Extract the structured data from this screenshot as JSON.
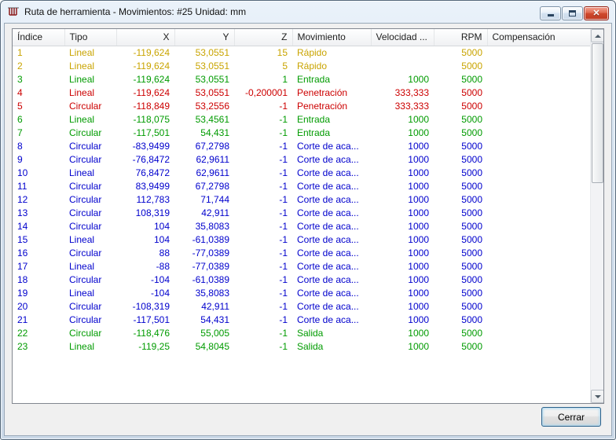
{
  "window": {
    "title": "Ruta de herramienta - Movimientos: #25 Unidad: mm"
  },
  "table": {
    "columns": [
      "Índice",
      "Tipo",
      "X",
      "Y",
      "Z",
      "Movimiento",
      "Velocidad ...",
      "RPM",
      "Compensación"
    ],
    "keys": [
      "indice",
      "tipo",
      "x",
      "y",
      "z",
      "movimiento",
      "velocidad",
      "rpm",
      "compensacion"
    ],
    "rows": [
      {
        "color": "rapido",
        "cells": [
          "1",
          "Lineal",
          "-119,624",
          "53,0551",
          "15",
          "Rápido",
          "",
          "5000",
          ""
        ]
      },
      {
        "color": "rapido",
        "cells": [
          "2",
          "Lineal",
          "-119,624",
          "53,0551",
          "5",
          "Rápido",
          "",
          "5000",
          ""
        ]
      },
      {
        "color": "entrada",
        "cells": [
          "3",
          "Lineal",
          "-119,624",
          "53,0551",
          "1",
          "Entrada",
          "1000",
          "5000",
          ""
        ]
      },
      {
        "color": "penetracion",
        "cells": [
          "4",
          "Lineal",
          "-119,624",
          "53,0551",
          "-0,200001",
          "Penetración",
          "333,333",
          "5000",
          ""
        ]
      },
      {
        "color": "penetracion",
        "cells": [
          "5",
          "Circular",
          "-118,849",
          "53,2556",
          "-1",
          "Penetración",
          "333,333",
          "5000",
          ""
        ]
      },
      {
        "color": "entrada",
        "cells": [
          "6",
          "Lineal",
          "-118,075",
          "53,4561",
          "-1",
          "Entrada",
          "1000",
          "5000",
          ""
        ]
      },
      {
        "color": "entrada",
        "cells": [
          "7",
          "Circular",
          "-117,501",
          "54,431",
          "-1",
          "Entrada",
          "1000",
          "5000",
          ""
        ]
      },
      {
        "color": "corte",
        "cells": [
          "8",
          "Circular",
          "-83,9499",
          "67,2798",
          "-1",
          "Corte de aca...",
          "1000",
          "5000",
          ""
        ]
      },
      {
        "color": "corte",
        "cells": [
          "9",
          "Circular",
          "-76,8472",
          "62,9611",
          "-1",
          "Corte de aca...",
          "1000",
          "5000",
          ""
        ]
      },
      {
        "color": "corte",
        "cells": [
          "10",
          "Lineal",
          "76,8472",
          "62,9611",
          "-1",
          "Corte de aca...",
          "1000",
          "5000",
          ""
        ]
      },
      {
        "color": "corte",
        "cells": [
          "11",
          "Circular",
          "83,9499",
          "67,2798",
          "-1",
          "Corte de aca...",
          "1000",
          "5000",
          ""
        ]
      },
      {
        "color": "corte",
        "cells": [
          "12",
          "Circular",
          "112,783",
          "71,744",
          "-1",
          "Corte de aca...",
          "1000",
          "5000",
          ""
        ]
      },
      {
        "color": "corte",
        "cells": [
          "13",
          "Circular",
          "108,319",
          "42,911",
          "-1",
          "Corte de aca...",
          "1000",
          "5000",
          ""
        ]
      },
      {
        "color": "corte",
        "cells": [
          "14",
          "Circular",
          "104",
          "35,8083",
          "-1",
          "Corte de aca...",
          "1000",
          "5000",
          ""
        ]
      },
      {
        "color": "corte",
        "cells": [
          "15",
          "Lineal",
          "104",
          "-61,0389",
          "-1",
          "Corte de aca...",
          "1000",
          "5000",
          ""
        ]
      },
      {
        "color": "corte",
        "cells": [
          "16",
          "Circular",
          "88",
          "-77,0389",
          "-1",
          "Corte de aca...",
          "1000",
          "5000",
          ""
        ]
      },
      {
        "color": "corte",
        "cells": [
          "17",
          "Lineal",
          "-88",
          "-77,0389",
          "-1",
          "Corte de aca...",
          "1000",
          "5000",
          ""
        ]
      },
      {
        "color": "corte",
        "cells": [
          "18",
          "Circular",
          "-104",
          "-61,0389",
          "-1",
          "Corte de aca...",
          "1000",
          "5000",
          ""
        ]
      },
      {
        "color": "corte",
        "cells": [
          "19",
          "Lineal",
          "-104",
          "35,8083",
          "-1",
          "Corte de aca...",
          "1000",
          "5000",
          ""
        ]
      },
      {
        "color": "corte",
        "cells": [
          "20",
          "Circular",
          "-108,319",
          "42,911",
          "-1",
          "Corte de aca...",
          "1000",
          "5000",
          ""
        ]
      },
      {
        "color": "corte",
        "cells": [
          "21",
          "Circular",
          "-117,501",
          "54,431",
          "-1",
          "Corte de aca...",
          "1000",
          "5000",
          ""
        ]
      },
      {
        "color": "salida",
        "cells": [
          "22",
          "Circular",
          "-118,476",
          "55,005",
          "-1",
          "Salida",
          "1000",
          "5000",
          ""
        ]
      },
      {
        "color": "salida",
        "cells": [
          "23",
          "Lineal",
          "-119,25",
          "54,8045",
          "-1",
          "Salida",
          "1000",
          "5000",
          ""
        ]
      }
    ]
  },
  "colors": {
    "rapido": "#C9A400",
    "entrada": "#009B00",
    "penetracion": "#CC0000",
    "corte": "#0000CD",
    "salida": "#009B00"
  },
  "footer": {
    "close_label": "Cerrar"
  }
}
